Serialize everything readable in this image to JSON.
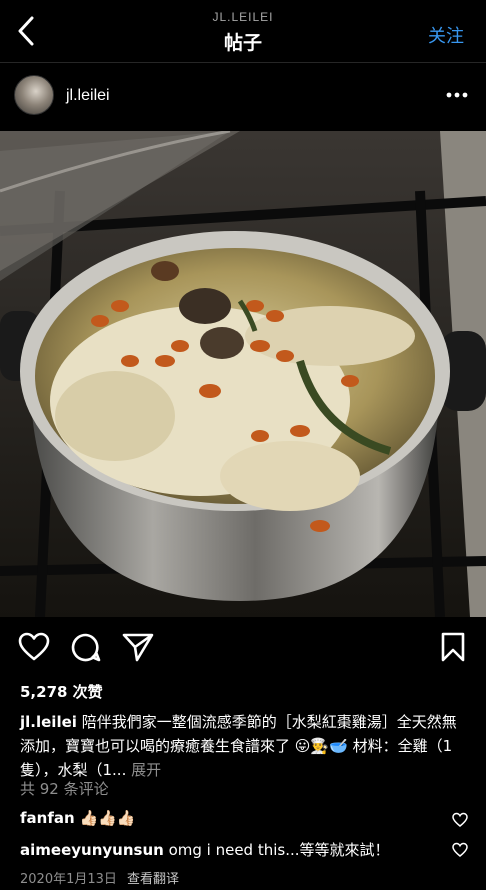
{
  "header": {
    "account": "JL.LEILEI",
    "title": "帖子",
    "follow_label": "关注",
    "back_icon": "chevron-left-icon"
  },
  "author": {
    "username": "jl.leilei",
    "more_icon": "more-horizontal-icon"
  },
  "post": {
    "likes_text": "5,278 次赞",
    "caption_user": "jl.leilei",
    "caption_text": "陪伴我們家一整個流感季節的［水梨紅棗雞湯］全天然無添加，寶寶也可以喝的療癒養生食譜來了",
    "caption_emojis": "😛👨‍🍳🥣",
    "caption_tail": "材料：全雞（1隻），水梨（1...",
    "expand_label": "展开",
    "comments_count_label": "共 92 条评论",
    "date": "2020年1月13日",
    "translate_label": "查看翻译"
  },
  "comments": [
    {
      "user": "fanfan",
      "text": "👍🏻👍🏻👍🏻"
    },
    {
      "user": "aimeeyunyunsun",
      "text": "omg i need this...等等就來試！"
    }
  ],
  "colors": {
    "background": "#000000",
    "accent": "#3897f0",
    "muted": "#8e8e8e"
  }
}
